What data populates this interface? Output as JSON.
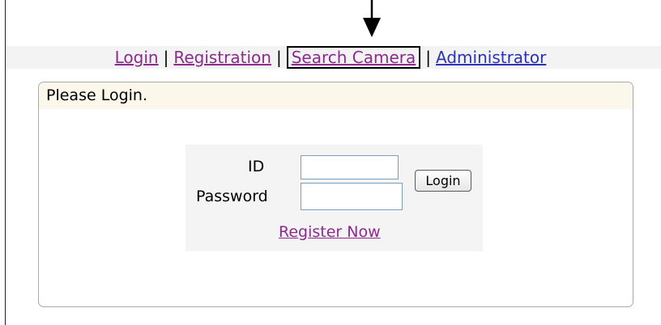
{
  "nav": {
    "login": "Login",
    "registration": "Registration",
    "search_camera": "Search Camera",
    "administrator": "Administrator",
    "separator": "|"
  },
  "panel": {
    "title": "Please Login."
  },
  "form": {
    "id_label": "ID",
    "password_label": "Password",
    "id_value": "",
    "password_value": "",
    "login_button": "Login",
    "register_link": "Register Now"
  },
  "colors": {
    "visited_link": "#8b2b8e",
    "link": "#2b31b8",
    "panel_header_bg": "#fbf7eb",
    "input_border": "#7b9ebd"
  },
  "icons": {
    "callout": "down-arrow-icon"
  }
}
